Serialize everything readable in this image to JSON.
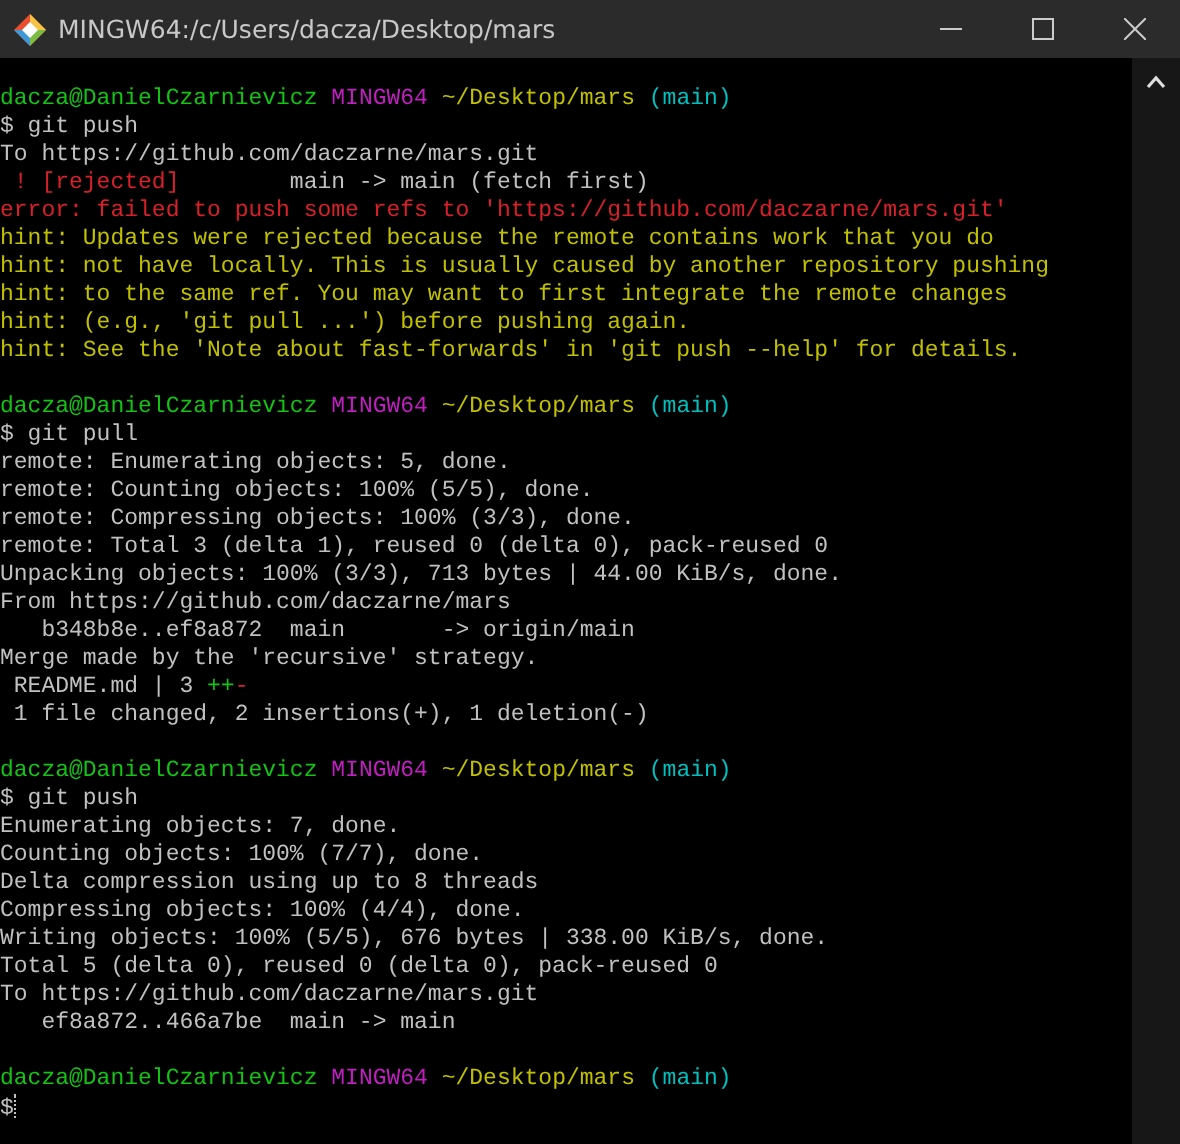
{
  "window": {
    "title": "MINGW64:/c/Users/dacza/Desktop/mars"
  },
  "blocks": [
    {
      "lines": [
        [
          {
            "text": "dacza@DanielCzarnievicz",
            "kind": "user"
          },
          {
            "text": " MINGW64",
            "kind": "host"
          },
          {
            "text": " ~/Desktop/mars",
            "kind": "path"
          },
          {
            "text": " (main)",
            "kind": "branch"
          }
        ],
        [
          {
            "text": "$ git push",
            "kind": "plain"
          }
        ],
        [
          {
            "text": "To https://github.com/daczarne/mars.git",
            "kind": "plain"
          }
        ],
        [
          {
            "text": " ! [rejected]",
            "kind": "error"
          },
          {
            "text": "        main -> main (fetch first)",
            "kind": "plain"
          }
        ],
        [
          {
            "text": "error: failed to push some refs to 'https://github.com/daczarne/mars.git'",
            "kind": "error"
          }
        ],
        [
          {
            "text": "hint: Updates were rejected because the remote contains work that you do",
            "kind": "hint"
          }
        ],
        [
          {
            "text": "hint: not have locally. This is usually caused by another repository pushing",
            "kind": "hint"
          }
        ],
        [
          {
            "text": "hint: to the same ref. You may want to first integrate the remote changes",
            "kind": "hint"
          }
        ],
        [
          {
            "text": "hint: (e.g., 'git pull ...') before pushing again.",
            "kind": "hint"
          }
        ],
        [
          {
            "text": "hint: See the 'Note about fast-forwards' in 'git push --help' for details.",
            "kind": "hint"
          }
        ]
      ]
    },
    {
      "lines": [
        [
          {
            "text": "dacza@DanielCzarnievicz",
            "kind": "user"
          },
          {
            "text": " MINGW64",
            "kind": "host"
          },
          {
            "text": " ~/Desktop/mars",
            "kind": "path"
          },
          {
            "text": " (main)",
            "kind": "branch"
          }
        ],
        [
          {
            "text": "$ git pull",
            "kind": "plain"
          }
        ],
        [
          {
            "text": "remote: Enumerating objects: 5, done.",
            "kind": "plain"
          }
        ],
        [
          {
            "text": "remote: Counting objects: 100% (5/5), done.",
            "kind": "plain"
          }
        ],
        [
          {
            "text": "remote: Compressing objects: 100% (3/3), done.",
            "kind": "plain"
          }
        ],
        [
          {
            "text": "remote: Total 3 (delta 1), reused 0 (delta 0), pack-reused 0",
            "kind": "plain"
          }
        ],
        [
          {
            "text": "Unpacking objects: 100% (3/3), 713 bytes | 44.00 KiB/s, done.",
            "kind": "plain"
          }
        ],
        [
          {
            "text": "From https://github.com/daczarne/mars",
            "kind": "plain"
          }
        ],
        [
          {
            "text": "   b348b8e..ef8a872  main       -> origin/main",
            "kind": "plain"
          }
        ],
        [
          {
            "text": "Merge made by the 'recursive' strategy.",
            "kind": "plain"
          }
        ],
        [
          {
            "text": " README.md | 3 ",
            "kind": "plain"
          },
          {
            "text": "++",
            "kind": "added"
          },
          {
            "text": "-",
            "kind": "removed"
          }
        ],
        [
          {
            "text": " 1 file changed, 2 insertions(+), 1 deletion(-)",
            "kind": "plain"
          }
        ]
      ]
    },
    {
      "lines": [
        [
          {
            "text": "dacza@DanielCzarnievicz",
            "kind": "user"
          },
          {
            "text": " MINGW64",
            "kind": "host"
          },
          {
            "text": " ~/Desktop/mars",
            "kind": "path"
          },
          {
            "text": " (main)",
            "kind": "branch"
          }
        ],
        [
          {
            "text": "$ git push",
            "kind": "plain"
          }
        ],
        [
          {
            "text": "Enumerating objects: 7, done.",
            "kind": "plain"
          }
        ],
        [
          {
            "text": "Counting objects: 100% (7/7), done.",
            "kind": "plain"
          }
        ],
        [
          {
            "text": "Delta compression using up to 8 threads",
            "kind": "plain"
          }
        ],
        [
          {
            "text": "Compressing objects: 100% (4/4), done.",
            "kind": "plain"
          }
        ],
        [
          {
            "text": "Writing objects: 100% (5/5), 676 bytes | 338.00 KiB/s, done.",
            "kind": "plain"
          }
        ],
        [
          {
            "text": "Total 5 (delta 0), reused 0 (delta 0), pack-reused 0",
            "kind": "plain"
          }
        ],
        [
          {
            "text": "To https://github.com/daczarne/mars.git",
            "kind": "plain"
          }
        ],
        [
          {
            "text": "   ef8a872..466a7be  main -> main",
            "kind": "plain"
          }
        ]
      ]
    },
    {
      "lines": [
        [
          {
            "text": "dacza@DanielCzarnievicz",
            "kind": "user"
          },
          {
            "text": " MINGW64",
            "kind": "host"
          },
          {
            "text": " ~/Desktop/mars",
            "kind": "path"
          },
          {
            "text": " (main)",
            "kind": "branch"
          }
        ],
        [
          {
            "text": "$",
            "kind": "plain"
          }
        ]
      ]
    }
  ],
  "cursor": {
    "visible": true
  }
}
